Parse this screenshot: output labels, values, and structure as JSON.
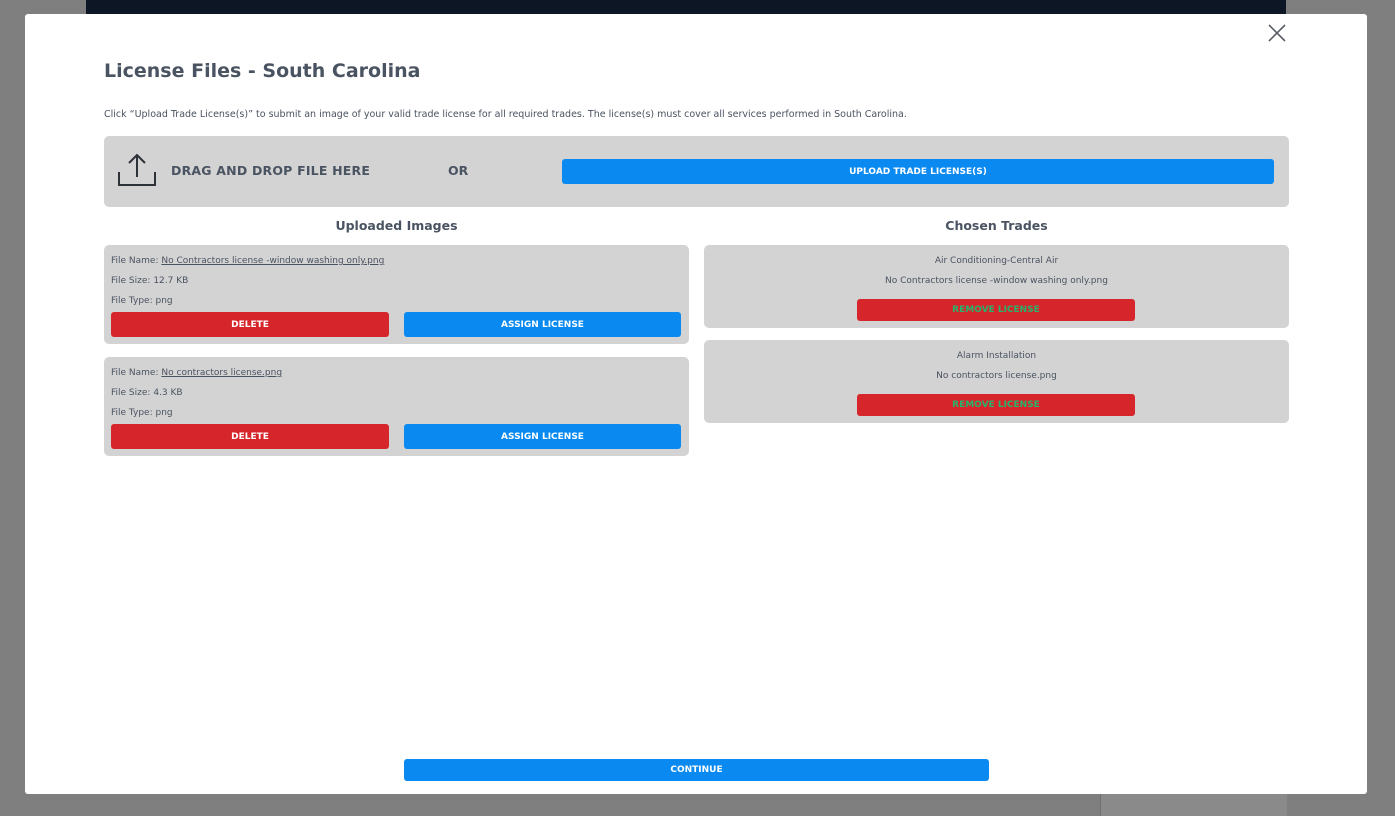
{
  "modal": {
    "title": "License Files - South Carolina",
    "instructions": "Click “Upload Trade License(s)” to submit an image of your valid trade license for all required trades. The license(s) must cover all services performed in South Carolina.",
    "close_icon": "close-icon"
  },
  "upload": {
    "icon": "upload-icon",
    "drag_text": "DRAG AND DROP FILE HERE",
    "or_text": "OR",
    "button_label": "UPLOAD TRADE LICENSE(S)"
  },
  "uploaded_images": {
    "heading": "Uploaded Images",
    "files": [
      {
        "name_label": "File Name:",
        "name": "No Contractors license -window washing only.png",
        "size_label": "File Size:",
        "size": "12.7 KB",
        "type_label": "File Type:",
        "type": "png",
        "delete_label": "DELETE",
        "assign_label": "ASSIGN LICENSE"
      },
      {
        "name_label": "File Name:",
        "name": "No contractors license.png",
        "size_label": "File Size:",
        "size": "4.3 KB",
        "type_label": "File Type:",
        "type": "png",
        "delete_label": "DELETE",
        "assign_label": "ASSIGN LICENSE"
      }
    ]
  },
  "chosen_trades": {
    "heading": "Chosen Trades",
    "trades": [
      {
        "trade": "Air Conditioning-Central Air",
        "file": "No Contractors license -window washing only.png",
        "remove_label": "REMOVE LICENSE"
      },
      {
        "trade": "Alarm Installation",
        "file": "No contractors license.png",
        "remove_label": "REMOVE LICENSE"
      }
    ]
  },
  "footer": {
    "continue_label": "CONTINUE"
  },
  "colors": {
    "primary_blue": "#0a8af0",
    "danger_red": "#d7262b",
    "remove_text_green": "#26b36b",
    "card_gray": "#d3d3d3",
    "text_slate": "#4a5361"
  }
}
